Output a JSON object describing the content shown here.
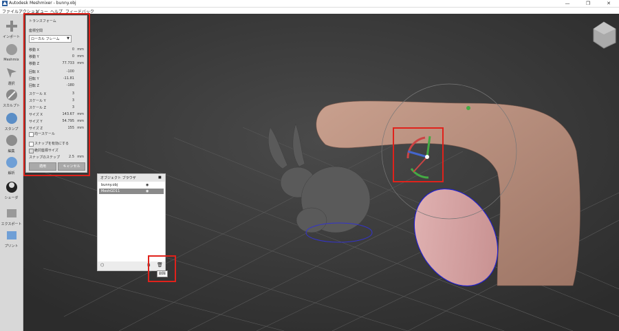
{
  "window": {
    "title": "Autodesk Meshmixer - bunny.obj",
    "minimize": "—",
    "maximize": "❐",
    "close": "✕"
  },
  "menu": [
    "ファイル",
    "アクション",
    "ビュー",
    "ヘルプ",
    "フィードバック"
  ],
  "tools": [
    {
      "label": "インポート",
      "icon": "import-plus-icon"
    },
    {
      "label": "Meshmix",
      "icon": "meshmix-sphere-icon"
    },
    {
      "label": "選択",
      "icon": "select-arrow-icon"
    },
    {
      "label": "スカルプト",
      "icon": "sculpt-brush-icon"
    },
    {
      "label": "スタンプ",
      "icon": "stamp-icon"
    },
    {
      "label": "編集",
      "icon": "edit-icon"
    },
    {
      "label": "解析",
      "icon": "analysis-icon"
    },
    {
      "label": "シェーダ",
      "icon": "shader-icon"
    },
    {
      "label": "エクスポート",
      "icon": "export-icon"
    },
    {
      "label": "プリント",
      "icon": "print-icon"
    }
  ],
  "transform": {
    "title": "トランスフォーム",
    "coord_label": "座標空間",
    "coord_value": "ローカル フレーム",
    "fields": [
      {
        "label": "移動 X",
        "value": "0",
        "unit": "mm"
      },
      {
        "label": "移動 Y",
        "value": "0",
        "unit": "mm"
      },
      {
        "label": "移動 Z",
        "value": "77.733",
        "unit": "mm"
      },
      {
        "label": "回転 X",
        "value": "-100",
        "unit": ""
      },
      {
        "label": "回転 Y",
        "value": "-11.81",
        "unit": ""
      },
      {
        "label": "回転 Z",
        "value": "-180",
        "unit": ""
      },
      {
        "label": "スケール X",
        "value": "3",
        "unit": ""
      },
      {
        "label": "スケール Y",
        "value": "3",
        "unit": ""
      },
      {
        "label": "スケール Z",
        "value": "3",
        "unit": ""
      },
      {
        "label": "サイズ X",
        "value": "143.67",
        "unit": "mm"
      },
      {
        "label": "サイズ Y",
        "value": "54.795",
        "unit": "mm"
      },
      {
        "label": "サイズ Z",
        "value": "155",
        "unit": "mm"
      }
    ],
    "uniform_scale": "均一スケール",
    "snap_enable": "スナップを有効にする",
    "absolute_size": "絶対座標サイズ",
    "snap_step_label": "スナップのステップ",
    "snap_step_value": "2.5",
    "snap_step_unit": "mm",
    "accept": "適用",
    "cancel": "キャンセル"
  },
  "object_browser": {
    "title": "オブジェクト ブラウザ",
    "items": [
      "bunny.obj",
      "MeshGD11"
    ],
    "tooltip": "削除"
  }
}
